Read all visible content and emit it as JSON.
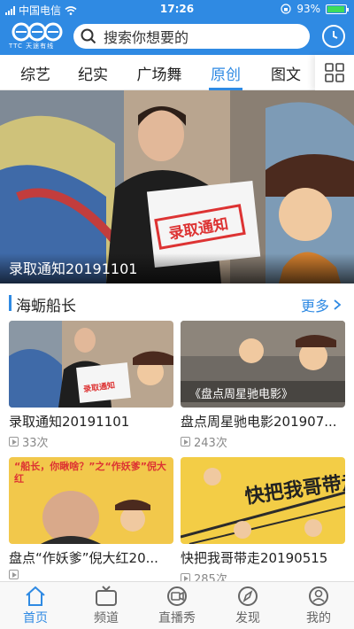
{
  "status_bar": {
    "carrier": "中国电信",
    "time": "17:26",
    "battery": "93%"
  },
  "header": {
    "logo_text": "TTC 天途有线",
    "search_placeholder": "搜索你想要的"
  },
  "tabs": [
    {
      "label": "综艺"
    },
    {
      "label": "纪实"
    },
    {
      "label": "广场舞"
    },
    {
      "label": "原创",
      "active": true
    },
    {
      "label": "图文"
    }
  ],
  "banner": {
    "caption": "录取通知20191101",
    "sign_text": "录取通知"
  },
  "section": {
    "title": "海蛎船长",
    "more": "更多"
  },
  "cards": [
    {
      "title": "录取通知20191101",
      "views": "33次"
    },
    {
      "title": "盘点周星驰电影201907...",
      "views": "243次",
      "thumb_text": "《盘点周星驰电影》"
    },
    {
      "title": "盘点“作妖爹”倪大红20...",
      "views": "",
      "thumb_text": "“船长，你瞅啥？”之“作妖爹”倪大红"
    },
    {
      "title": "快把我哥带走20190515",
      "views": "285次",
      "thumb_text": "快把我哥带走"
    }
  ],
  "bottom_nav": [
    {
      "label": "首页",
      "icon": "home-icon",
      "active": true
    },
    {
      "label": "频道",
      "icon": "tv-icon"
    },
    {
      "label": "直播秀",
      "icon": "live-icon"
    },
    {
      "label": "发现",
      "icon": "compass-icon"
    },
    {
      "label": "我的",
      "icon": "user-icon"
    }
  ],
  "colors": {
    "accent": "#2f8ae3",
    "battery": "#3ddc5b"
  }
}
